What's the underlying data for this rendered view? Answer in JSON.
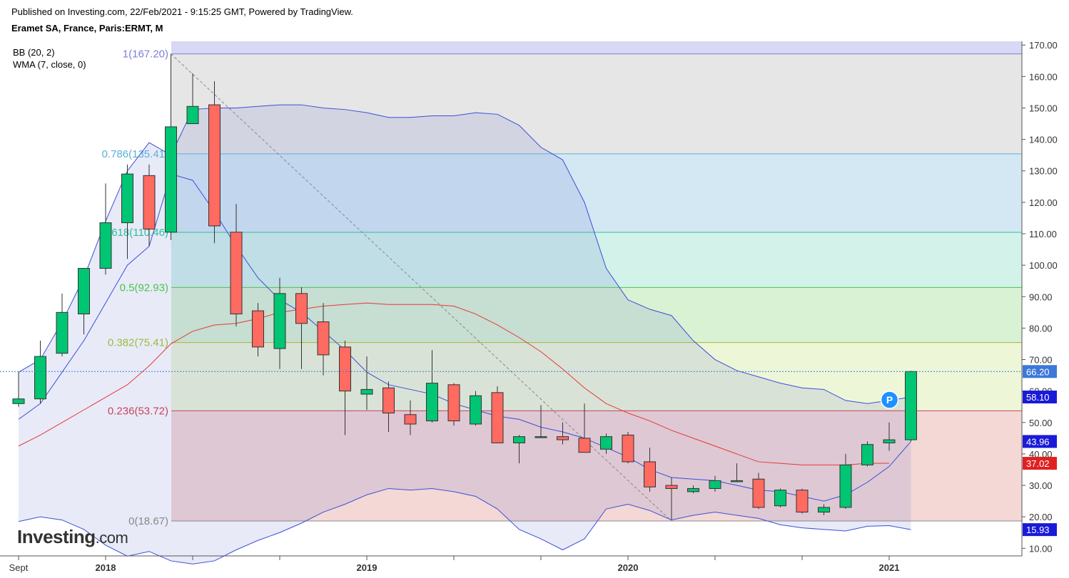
{
  "header": {
    "published": "Published on Investing.com, 22/Feb/2021 - 9:15:25 GMT, Powered by TradingView.",
    "symbol": "Eramet SA, France, Paris:ERMT, M"
  },
  "indicators": [
    "BB (20, 2)",
    "WMA (7, close, 0)"
  ],
  "logo": {
    "main": "Investing",
    "suffix": ".com"
  },
  "pivot_marker": "P",
  "colors": {
    "up": "#00c572",
    "down": "#ff6a61",
    "bb_line": "#3a4fd8",
    "wma_line": "#e53935",
    "fib_1": "#7b7fd9",
    "fib_0786": "#5ab0d8",
    "fib_0618": "#2fc0a0",
    "fib_05": "#4ac44a",
    "fib_0382": "#9cbc3c",
    "fib_0236": "#c8455b",
    "fib_0": "#888888"
  },
  "chart_data": {
    "type": "candlestick",
    "title": "Eramet SA, France, Paris:ERMT, M",
    "interval": "M",
    "ylim": [
      7,
      172
    ],
    "y_ticks": [
      "170.00",
      "160.00",
      "150.00",
      "140.00",
      "130.00",
      "120.00",
      "110.00",
      "100.00",
      "90.00",
      "80.00",
      "70.00",
      "60.00",
      "50.00",
      "40.00",
      "30.00",
      "20.00",
      "10.00"
    ],
    "x_labels": [
      {
        "label": "Sept",
        "month": "2017-09"
      },
      {
        "label": "2018",
        "month": "2018-01"
      },
      {
        "label": "2019",
        "month": "2019-01"
      },
      {
        "label": "2020",
        "month": "2020-01"
      },
      {
        "label": "2021",
        "month": "2021-01"
      }
    ],
    "candles": [
      {
        "m": "2017-09",
        "o": 56,
        "h": 66,
        "l": 55,
        "c": 57.5
      },
      {
        "m": "2017-10",
        "o": 57.5,
        "h": 76,
        "l": 56,
        "c": 71
      },
      {
        "m": "2017-11",
        "o": 72,
        "h": 91,
        "l": 71,
        "c": 85
      },
      {
        "m": "2017-12",
        "o": 84.5,
        "h": 95,
        "l": 78,
        "c": 99
      },
      {
        "m": "2018-01",
        "o": 99,
        "h": 126,
        "l": 97,
        "c": 113.5
      },
      {
        "m": "2018-02",
        "o": 113.5,
        "h": 132,
        "l": 102,
        "c": 129
      },
      {
        "m": "2018-03",
        "o": 128.5,
        "h": 132,
        "l": 106,
        "c": 111.5
      },
      {
        "m": "2018-04",
        "o": 110.5,
        "h": 167.2,
        "l": 108,
        "c": 144
      },
      {
        "m": "2018-05",
        "o": 145,
        "h": 161,
        "l": 145,
        "c": 150.5
      },
      {
        "m": "2018-06",
        "o": 151,
        "h": 158.5,
        "l": 107,
        "c": 112.5
      },
      {
        "m": "2018-07",
        "o": 110.5,
        "h": 119.5,
        "l": 80.5,
        "c": 84.5
      },
      {
        "m": "2018-08",
        "o": 85.5,
        "h": 88,
        "l": 71,
        "c": 74
      },
      {
        "m": "2018-09",
        "o": 73.5,
        "h": 96,
        "l": 67,
        "c": 91
      },
      {
        "m": "2018-10",
        "o": 91,
        "h": 93,
        "l": 67,
        "c": 81.5
      },
      {
        "m": "2018-11",
        "o": 82,
        "h": 88,
        "l": 65,
        "c": 71.5
      },
      {
        "m": "2018-12",
        "o": 74,
        "h": 76,
        "l": 46,
        "c": 60
      },
      {
        "m": "2019-01",
        "o": 59,
        "h": 71,
        "l": 54,
        "c": 60.5
      },
      {
        "m": "2019-02",
        "o": 61,
        "h": 63,
        "l": 47,
        "c": 53
      },
      {
        "m": "2019-03",
        "o": 52.5,
        "h": 57,
        "l": 46,
        "c": 49.5
      },
      {
        "m": "2019-04",
        "o": 50.5,
        "h": 73,
        "l": 50,
        "c": 62.5
      },
      {
        "m": "2019-05",
        "o": 62,
        "h": 62.5,
        "l": 49,
        "c": 50.5
      },
      {
        "m": "2019-06",
        "o": 49.5,
        "h": 60,
        "l": 49,
        "c": 58.5
      },
      {
        "m": "2019-07",
        "o": 59.5,
        "h": 61.5,
        "l": 43.5,
        "c": 43.5
      },
      {
        "m": "2019-08",
        "o": 43.5,
        "h": 46,
        "l": 37,
        "c": 45.5
      },
      {
        "m": "2019-09",
        "o": 45.5,
        "h": 55.5,
        "l": 45,
        "c": 45.5
      },
      {
        "m": "2019-10",
        "o": 45.5,
        "h": 50,
        "l": 43,
        "c": 44.5
      },
      {
        "m": "2019-11",
        "o": 45,
        "h": 56,
        "l": 41,
        "c": 40.5
      },
      {
        "m": "2019-12",
        "o": 41.5,
        "h": 46.5,
        "l": 40,
        "c": 45.5
      },
      {
        "m": "2020-01",
        "o": 46,
        "h": 47,
        "l": 37,
        "c": 37.5
      },
      {
        "m": "2020-02",
        "o": 37.5,
        "h": 42,
        "l": 28,
        "c": 29.5
      },
      {
        "m": "2020-03",
        "o": 30,
        "h": 32.5,
        "l": 19,
        "c": 29
      },
      {
        "m": "2020-04",
        "o": 28,
        "h": 30,
        "l": 27.5,
        "c": 29
      },
      {
        "m": "2020-05",
        "o": 29,
        "h": 33,
        "l": 28,
        "c": 31.5
      },
      {
        "m": "2020-06",
        "o": 31.5,
        "h": 37,
        "l": 31,
        "c": 31.5
      },
      {
        "m": "2020-07",
        "o": 32,
        "h": 34,
        "l": 22.5,
        "c": 23
      },
      {
        "m": "2020-08",
        "o": 23.5,
        "h": 29,
        "l": 23,
        "c": 28.5
      },
      {
        "m": "2020-09",
        "o": 28.5,
        "h": 29,
        "l": 21,
        "c": 21.5
      },
      {
        "m": "2020-10",
        "o": 21.5,
        "h": 24,
        "l": 20.5,
        "c": 23
      },
      {
        "m": "2020-11",
        "o": 23,
        "h": 40,
        "l": 22.5,
        "c": 36.5
      },
      {
        "m": "2020-12",
        "o": 36.5,
        "h": 44,
        "l": 36,
        "c": 43
      },
      {
        "m": "2021-01",
        "o": 43.5,
        "h": 50,
        "l": 41,
        "c": 44.5
      },
      {
        "m": "2021-02",
        "o": 44.5,
        "h": 66.5,
        "l": 44,
        "c": 66.2
      }
    ],
    "bollinger": {
      "name": "BB (20, 2)",
      "upper": [
        66,
        70,
        82,
        96,
        114,
        130,
        139,
        135,
        149.5,
        150,
        150,
        150.5,
        151,
        151,
        150,
        149.5,
        148.5,
        147,
        147,
        147.5,
        147.5,
        148.5,
        148,
        144.5,
        137.5,
        133.5,
        120,
        99,
        89,
        86,
        84,
        76,
        70,
        66.5,
        64.5,
        62.5,
        61,
        60.5,
        57,
        56,
        57,
        58.1
      ],
      "middle": [
        51,
        56,
        66,
        76,
        88,
        100,
        106,
        129,
        127,
        117,
        106,
        96,
        89,
        85,
        79,
        73,
        66,
        62,
        60.5,
        59,
        56,
        54,
        52,
        51,
        48.5,
        47,
        45,
        42,
        39,
        35,
        32.5,
        32,
        31.5,
        30,
        28.5,
        28,
        26.5,
        25,
        27,
        31,
        36,
        43.96
      ],
      "lower": [
        18.5,
        20,
        19,
        16,
        11,
        7.5,
        9,
        6,
        5,
        6,
        9.5,
        12.5,
        15,
        18,
        21.5,
        24,
        27,
        29,
        28.5,
        29,
        28,
        26.5,
        22.5,
        16,
        13,
        9.5,
        13,
        22.5,
        24,
        22,
        19,
        20.5,
        21.5,
        20.5,
        19.5,
        17.5,
        16.5,
        16,
        15.5,
        17,
        17.2,
        15.93
      ]
    },
    "wma": {
      "name": "WMA (7, close, 0)",
      "values": [
        42.5,
        46,
        50,
        54,
        58,
        62,
        68,
        75,
        79,
        81,
        81.5,
        83,
        85,
        86,
        87,
        87.5,
        88,
        87.5,
        87.5,
        87.5,
        87,
        84.5,
        81,
        77,
        72.5,
        67,
        61,
        56,
        53,
        50.5,
        47.5,
        45,
        42.5,
        40,
        37.5,
        37,
        36.5,
        36.5,
        36.5,
        37,
        37.02
      ]
    },
    "fibonacci": [
      {
        "ratio": 1,
        "label": "1(167.20)",
        "value": 167.2
      },
      {
        "ratio": 0.786,
        "label": "0.786(135.41)",
        "value": 135.41
      },
      {
        "ratio": 0.618,
        "label": "0.618(110.46)",
        "value": 110.46
      },
      {
        "ratio": 0.5,
        "label": "0.5(92.93)",
        "value": 92.93
      },
      {
        "ratio": 0.382,
        "label": "0.382(75.41)",
        "value": 75.41
      },
      {
        "ratio": 0.236,
        "label": "0.236(53.72)",
        "value": 53.72
      },
      {
        "ratio": 0,
        "label": "0(18.67)",
        "value": 18.67
      }
    ],
    "price_tags": [
      {
        "label": "66.20",
        "value": 66.2,
        "color": "#3c78d8"
      },
      {
        "label": "58.10",
        "value": 58.1,
        "color": "#1a1ad8"
      },
      {
        "label": "43.96",
        "value": 43.96,
        "color": "#1a1ad8"
      },
      {
        "label": "37.02",
        "value": 37.02,
        "color": "#e02020"
      },
      {
        "label": "15.93",
        "value": 15.93,
        "color": "#1a1ad8"
      }
    ]
  }
}
